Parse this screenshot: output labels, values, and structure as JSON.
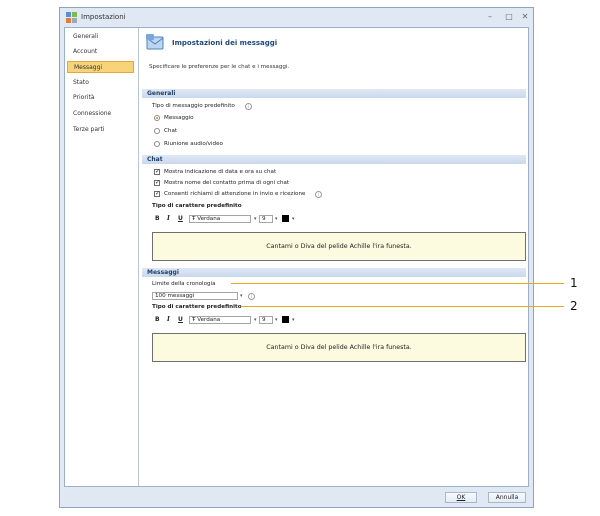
{
  "window": {
    "title": "Impostazioni",
    "min": "–",
    "max": "□",
    "close": "✕"
  },
  "nav": {
    "items": [
      {
        "label": "Generali"
      },
      {
        "label": "Account"
      },
      {
        "label": "Messaggi",
        "selected": true
      },
      {
        "label": "Stato"
      },
      {
        "label": "Priorità"
      },
      {
        "label": "Connessione"
      },
      {
        "label": "Terze parti"
      }
    ]
  },
  "header": {
    "title": "Impostazioni dei messaggi",
    "description": "Specificare le preferenze per le chat e i messaggi."
  },
  "generali": {
    "section_label": "Generali",
    "type_label": "Tipo di messaggio predefinito",
    "options": [
      "Messaggio",
      "Chat",
      "Riunione audio/video"
    ],
    "selected": "Messaggio"
  },
  "chat": {
    "section_label": "Chat",
    "checks": [
      "Mostra indicazione di data e ora su chat",
      "Mostra nome del contatto prima di ogni chat",
      "Consenti richiami di attenzione in invio e ricezione"
    ],
    "font_label": "Tipo di carattere predefinito",
    "bold": "B",
    "italic": "I",
    "underline": "U",
    "font_glyph": "Ŧ",
    "font_name": "Verdana",
    "font_size": "9",
    "preview": "Cantami o Diva del pelide Achille l'ira funesta."
  },
  "messaggi": {
    "section_label": "Messaggi",
    "history_label": "Limite della cronologia",
    "history_value": "100 messaggi",
    "font_label": "Tipo di carattere predefinito",
    "bold": "B",
    "italic": "I",
    "underline": "U",
    "font_glyph": "Ŧ",
    "font_name": "Verdana",
    "font_size": "9",
    "preview": "Cantami o Diva del pelide Achille l'ira funesta."
  },
  "footer": {
    "ok": "OK",
    "cancel": "Annulla"
  },
  "callouts": [
    "1",
    "2"
  ],
  "colors": {
    "accent": "#f7d47a",
    "section": "#c9d8eb",
    "preview_bg": "#fcfbe0",
    "callout": "#e5a81f"
  }
}
